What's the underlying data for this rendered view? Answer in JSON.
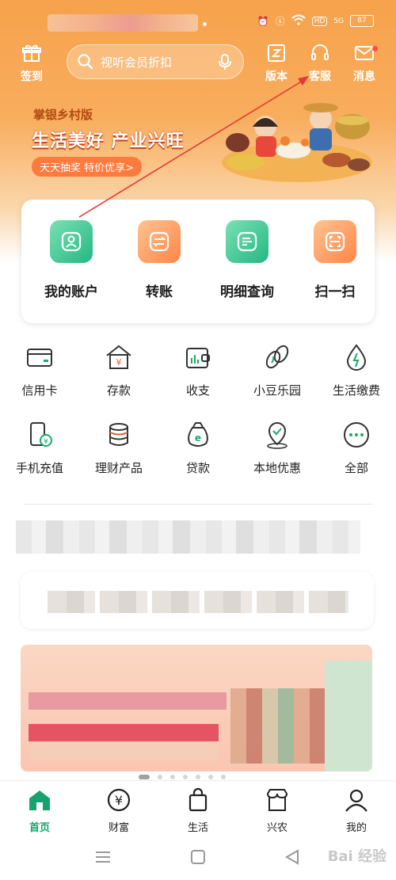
{
  "status_bar": {
    "battery": "87",
    "network": "5G",
    "hd": "HD"
  },
  "top_bar": {
    "checkin_label": "签到",
    "search_placeholder": "视听会员折扣",
    "version_label": "版本",
    "service_label": "客服",
    "message_label": "消息"
  },
  "banner": {
    "brand": "掌银乡村版",
    "slogan": "生活美好 产业兴旺",
    "pill": "天天抽奖 特价优享>"
  },
  "main_functions": [
    {
      "label": "我的账户",
      "icon": "account-icon"
    },
    {
      "label": "转账",
      "icon": "transfer-icon"
    },
    {
      "label": "明细查询",
      "icon": "statement-icon"
    },
    {
      "label": "扫一扫",
      "icon": "scan-icon"
    }
  ],
  "services": [
    {
      "label": "信用卡",
      "icon": "credit-card-icon"
    },
    {
      "label": "存款",
      "icon": "deposit-icon"
    },
    {
      "label": "收支",
      "icon": "wallet-icon"
    },
    {
      "label": "小豆乐园",
      "icon": "beans-icon"
    },
    {
      "label": "生活缴费",
      "icon": "utility-icon"
    },
    {
      "label": "手机充值",
      "icon": "phone-topup-icon"
    },
    {
      "label": "理财产品",
      "icon": "wealth-icon"
    },
    {
      "label": "贷款",
      "icon": "loan-icon"
    },
    {
      "label": "本地优惠",
      "icon": "local-offer-icon"
    },
    {
      "label": "全部",
      "icon": "more-icon"
    }
  ],
  "bottom_nav": [
    {
      "label": "首页",
      "icon": "home-icon",
      "active": true
    },
    {
      "label": "财富",
      "icon": "wealth-nav-icon"
    },
    {
      "label": "生活",
      "icon": "shopping-bag-icon"
    },
    {
      "label": "兴农",
      "icon": "store-icon"
    },
    {
      "label": "我的",
      "icon": "profile-icon"
    }
  ],
  "colors": {
    "accent_green": "#16a36d",
    "header_orange": "#f7a24c",
    "annotation_red": "#e53935"
  }
}
